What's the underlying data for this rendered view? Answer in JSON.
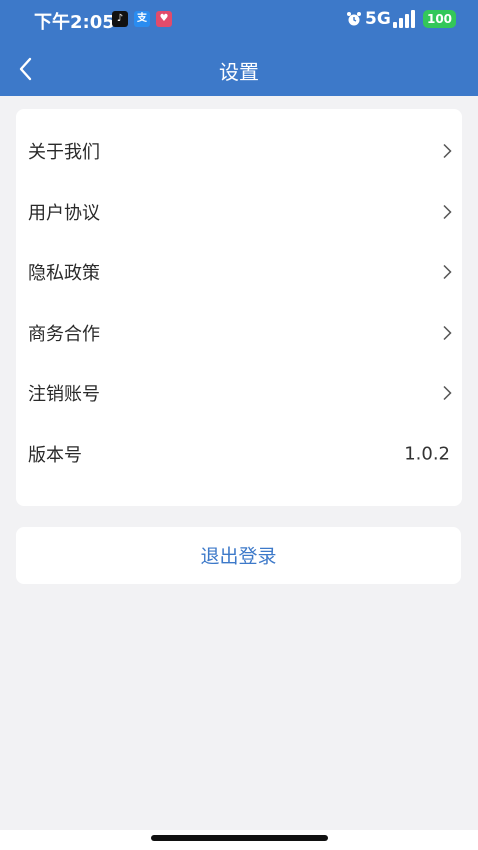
{
  "status_bar": {
    "time": "下午2:05",
    "network": "5G",
    "battery": "100"
  },
  "nav": {
    "title": "设置"
  },
  "settings": {
    "items": [
      {
        "label": "关于我们"
      },
      {
        "label": "用户协议"
      },
      {
        "label": "隐私政策"
      },
      {
        "label": "商务合作"
      },
      {
        "label": "注销账号"
      }
    ],
    "version": {
      "label": "版本号",
      "value": "1.0.2"
    }
  },
  "logout": {
    "label": "退出登录"
  },
  "colors": {
    "primary": "#3d79c9",
    "background": "#f2f2f4",
    "card": "#ffffff",
    "battery": "#33c759"
  }
}
